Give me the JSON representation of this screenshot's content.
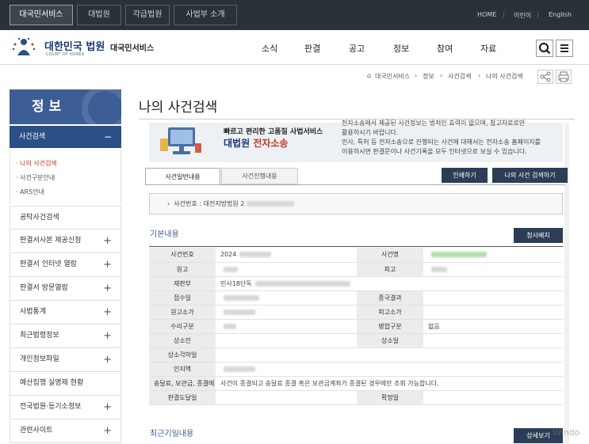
{
  "topbar": {
    "tabs": [
      "대국민서비스",
      "대법원",
      "각급법원",
      "사법부 소개"
    ],
    "utility": [
      "HOME",
      "어린이",
      "English"
    ]
  },
  "header": {
    "logo_title": "대한민국 법원",
    "logo_sub": "COURT OF KOREA",
    "service_name": "대국민서비스",
    "nav": [
      "소식",
      "판결",
      "공고",
      "정보",
      "참여",
      "자료"
    ]
  },
  "breadcrumb": [
    "대국민서비스",
    "정보",
    "사건검색",
    "나의 사건검색"
  ],
  "sidebar": {
    "title": "정 보",
    "active": {
      "label": "사건검색",
      "toggle": "−"
    },
    "subitems": [
      {
        "label": "· 나의 사건검색",
        "active": true
      },
      {
        "label": "· 사건구분안내",
        "active": false
      },
      {
        "label": "· ARS안내",
        "active": false
      }
    ],
    "items": [
      {
        "label": "공탁사건검색",
        "toggle": ""
      },
      {
        "label": "판결서사본 제공신청",
        "toggle": "+"
      },
      {
        "label": "판결서 인터넷 열람",
        "toggle": "+"
      },
      {
        "label": "판결서 방문열람",
        "toggle": "+"
      },
      {
        "label": "사법통계",
        "toggle": "+"
      },
      {
        "label": "최근법령정보",
        "toggle": "+"
      },
      {
        "label": "개인정보파일",
        "toggle": "+"
      },
      {
        "label": "예산집행 실명제 현황",
        "toggle": ""
      },
      {
        "label": "전국법원·등기소정보",
        "toggle": "+"
      },
      {
        "label": "관련사이트",
        "toggle": "+"
      }
    ]
  },
  "page_title": "나의 사건검색",
  "banner": {
    "line1": "빠르고 편리한 고품질 사법서비스",
    "line2_main": "대법원",
    "line2_red": "전자소송",
    "desc": [
      "전자소송에서 제공된 사건정보는 법적인 효력이 없으며, 참고자료로만",
      "활용하시기 바랍니다.",
      "민사, 특허 등 전자소송으로 진행되는 사건에 대해서는 전자소송 홈페이지를",
      "이용하시면 판결문이나 사건기록을 모두 인터넷으로 보실 수 있습니다."
    ]
  },
  "tabs": {
    "general": "사건일반내용",
    "progress": "사건진행내용"
  },
  "buttons": {
    "print": "인쇄하기",
    "my_search": "나의 사건 검색하기",
    "cheongsa": "청사배치",
    "detail": "상세보기"
  },
  "case_number_line": "사건번호 : 대전지방법원 2",
  "section_basic": "기본내용",
  "section_recent": "최근기일내용",
  "info_rows": [
    [
      {
        "h": "사건번호"
      },
      {
        "v": "2024",
        "blur": 40
      },
      {
        "h": "사건명"
      },
      {
        "v": "",
        "blur": 70,
        "green": true
      }
    ],
    [
      {
        "h": "원고"
      },
      {
        "v": "",
        "blur": 18
      },
      {
        "h": "피고"
      },
      {
        "v": "",
        "blur": 20
      }
    ],
    [
      {
        "h": "재판부"
      },
      {
        "v": "민사18단독",
        "blur": 120,
        "span": 3
      }
    ],
    [
      {
        "h": "접수일"
      },
      {
        "v": "",
        "blur": 45
      },
      {
        "h": "종국결과"
      },
      {
        "v": ""
      }
    ],
    [
      {
        "h": "원고소가"
      },
      {
        "v": "",
        "blur": 40
      },
      {
        "h": "피고소가"
      },
      {
        "v": ""
      }
    ],
    [
      {
        "h": "수리구분"
      },
      {
        "v": "",
        "blur": 16
      },
      {
        "h": "병합구분"
      },
      {
        "v": "없음"
      }
    ],
    [
      {
        "h": "상소인"
      },
      {
        "v": ""
      },
      {
        "h": "상소일"
      },
      {
        "v": ""
      }
    ],
    [
      {
        "h": "상소각하일"
      },
      {
        "v": "",
        "span": 3
      }
    ],
    [
      {
        "h": "인지액"
      },
      {
        "v": "",
        "blur": 40,
        "span": 3
      }
    ],
    [
      {
        "h": "송달료, 보관금, 종결에 따른 잔액조회"
      },
      {
        "v": "사건이 종결되고 송달료 종결 혹은 보관금계좌가 종결된 경우에만 조회 가능합니다.",
        "span": 3
      }
    ],
    [
      {
        "h": "판결도달일"
      },
      {
        "v": ""
      },
      {
        "h": "확정일"
      },
      {
        "v": ""
      }
    ]
  ],
  "watermark": "Windo"
}
